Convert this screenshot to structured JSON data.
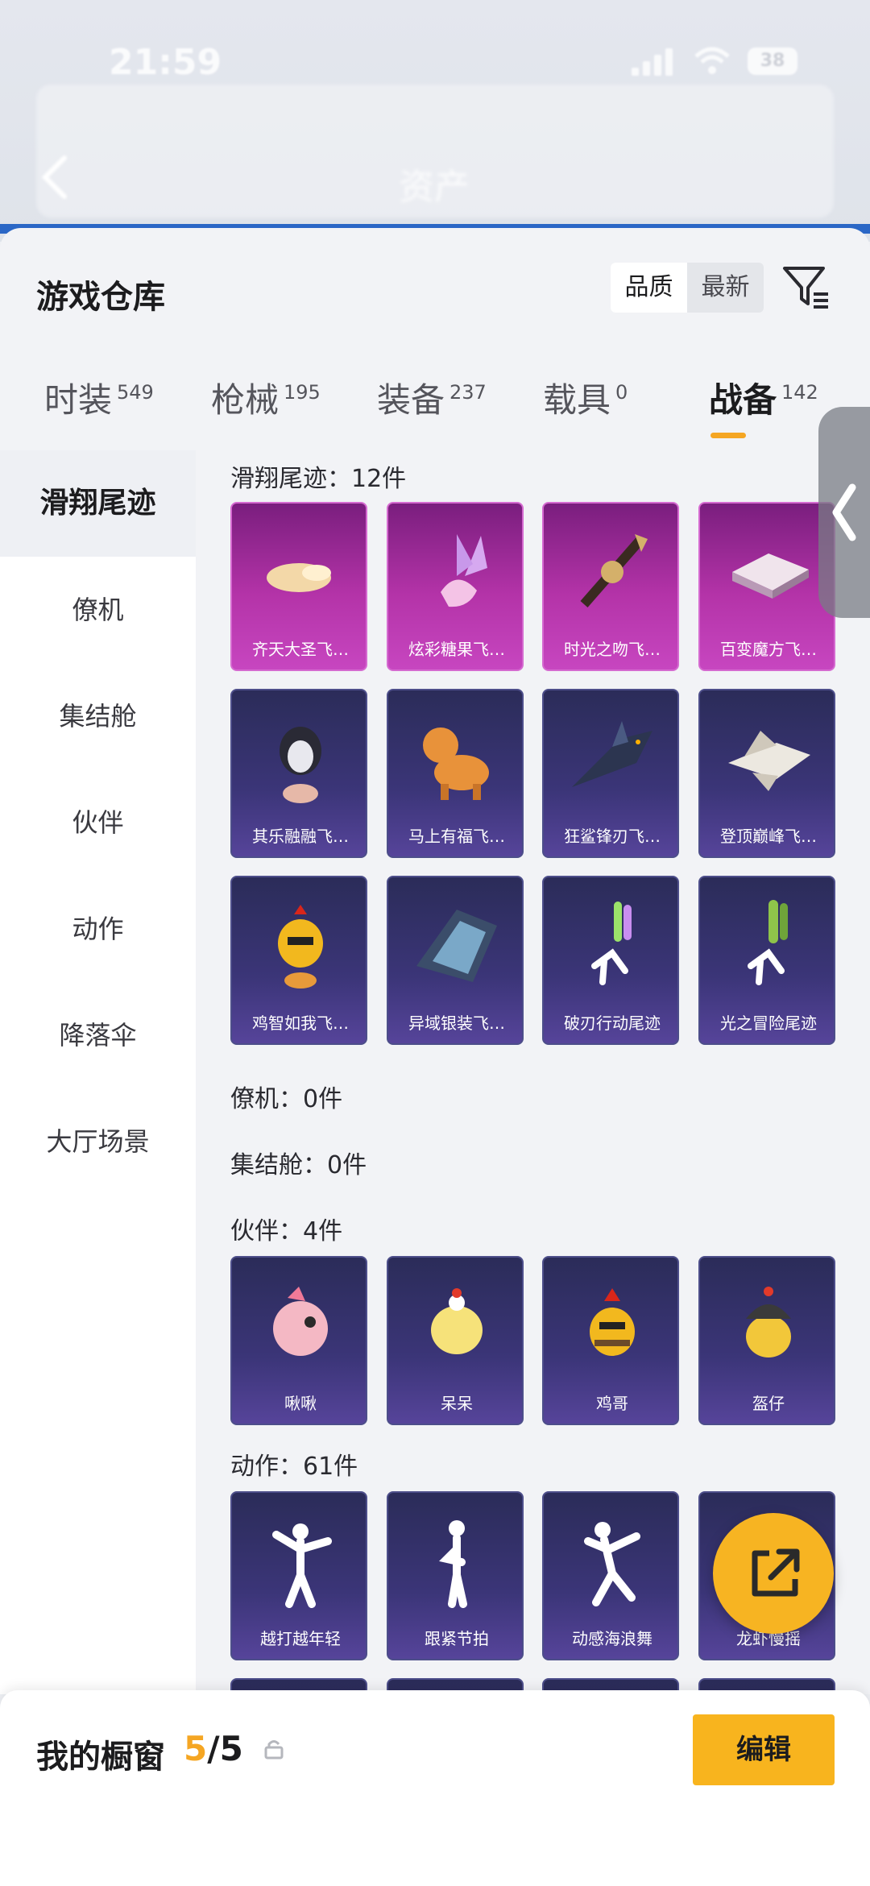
{
  "status": {
    "time": "21:59",
    "battery": "38"
  },
  "header": {
    "title": "资产"
  },
  "panel": {
    "title": "游戏仓库",
    "sort": [
      "品质",
      "最新"
    ]
  },
  "tabs": [
    {
      "label": "时装",
      "count": "549"
    },
    {
      "label": "枪械",
      "count": "195"
    },
    {
      "label": "装备",
      "count": "237"
    },
    {
      "label": "载具",
      "count": "0"
    },
    {
      "label": "战备",
      "count": "142"
    }
  ],
  "sidebar": [
    "滑翔尾迹",
    "僚机",
    "集结舱",
    "伙伴",
    "动作",
    "降落伞",
    "大厅场景"
  ],
  "sections": {
    "glide": {
      "title": "滑翔尾迹：12件",
      "items": [
        "齐天大圣飞…",
        "炫彩糖果飞…",
        "时光之吻飞…",
        "百变魔方飞…",
        "其乐融融飞…",
        "马上有福飞…",
        "狂鲨锋刃飞…",
        "登顶巅峰飞…",
        "鸡智如我飞…",
        "异域银装飞…",
        "破刃行动尾迹",
        "光之冒险尾迹"
      ]
    },
    "wingman": {
      "title": "僚机：0件"
    },
    "capsule": {
      "title": "集结舱：0件"
    },
    "partner": {
      "title": "伙伴：4件",
      "items": [
        "啾啾",
        "呆呆",
        "鸡哥",
        "盔仔"
      ]
    },
    "emote": {
      "title": "动作：61件",
      "items": [
        "越打越年轻",
        "跟紧节拍",
        "动感海浪舞",
        "龙虾慢摇"
      ]
    }
  },
  "showcase": {
    "label": "我的橱窗",
    "current": "5",
    "total": "/5",
    "edit": "编辑"
  },
  "colors": {
    "accent": "#f5a623",
    "button": "#f8b41e",
    "card_legendary": "#b433a8",
    "card_epic": "#3b3578"
  }
}
